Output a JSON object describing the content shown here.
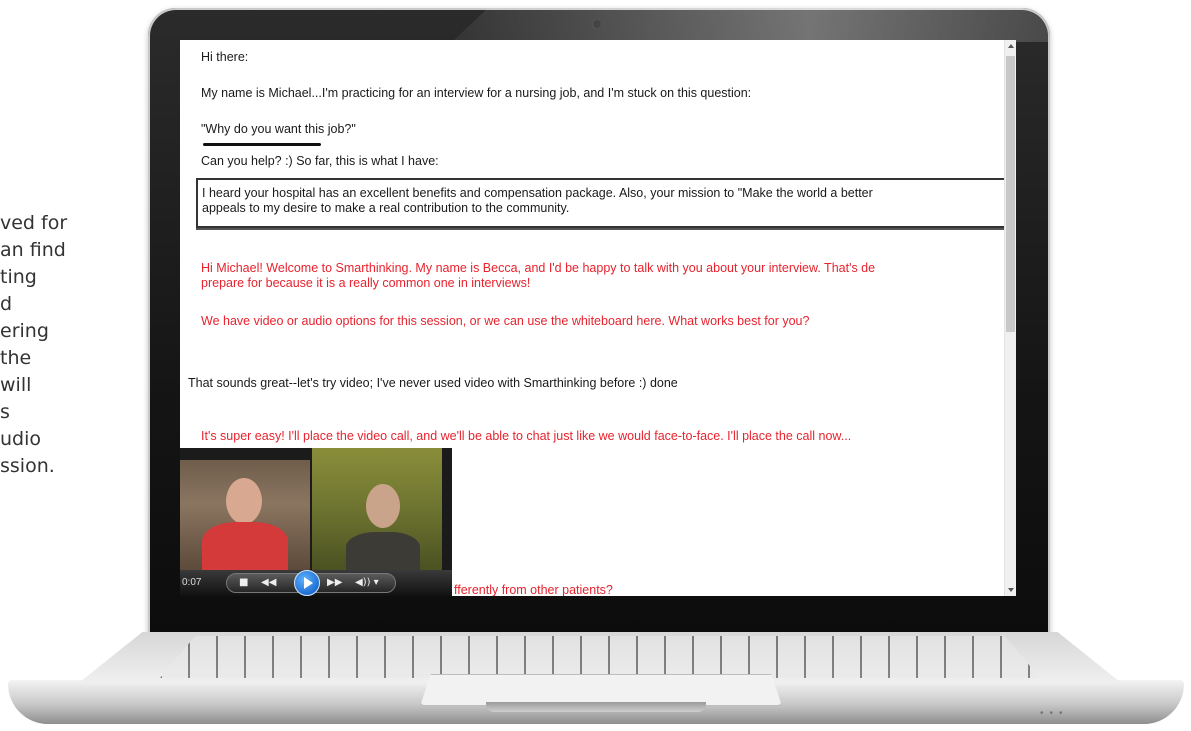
{
  "side_caption": {
    "lines": [
      "ved for",
      "an find",
      "ting",
      "d",
      "ering",
      "the",
      "will",
      "s",
      "udio",
      "ssion."
    ]
  },
  "chat": {
    "greeting": "Hi there:",
    "intro": "My name is Michael...I'm practicing for an interview for a nursing job, and I'm stuck on this question:",
    "question": "\"Why do you want this job?\"",
    "help": "Can you help? :) So far, this is what I have:",
    "draft_line1": "I heard your hospital has an excellent benefits and compensation package. Also, your mission to \"Make the world a better",
    "draft_line2": "appeals to my desire to make a real contribution to the community.",
    "tutor_line1": "Hi Michael! Welcome to Smarthinking. My name is Becca, and I'd be happy to talk with you about your interview. That's de",
    "tutor_line2": "prepare for because it is a really common one in interviews!",
    "tutor_options": "We have video or audio options for this session, or we can use the whiteboard here. What works best for you?",
    "student_reply": "That sounds great--let's try video; I've never used video with Smarthinking before :) done",
    "tutor_call": "It's super easy! I'll place the video call, and we'll be able to chat just like we would face-to-face. I'll place the call now...",
    "cut_off": "fferently from other patients?"
  },
  "video": {
    "time": "0:07",
    "stop": "■",
    "rewind": "◀◀",
    "forward": "▶▶",
    "volume": "◀)) ▾"
  },
  "colors": {
    "tutor_text": "#e8232e",
    "student_text": "#1a1a1a"
  }
}
